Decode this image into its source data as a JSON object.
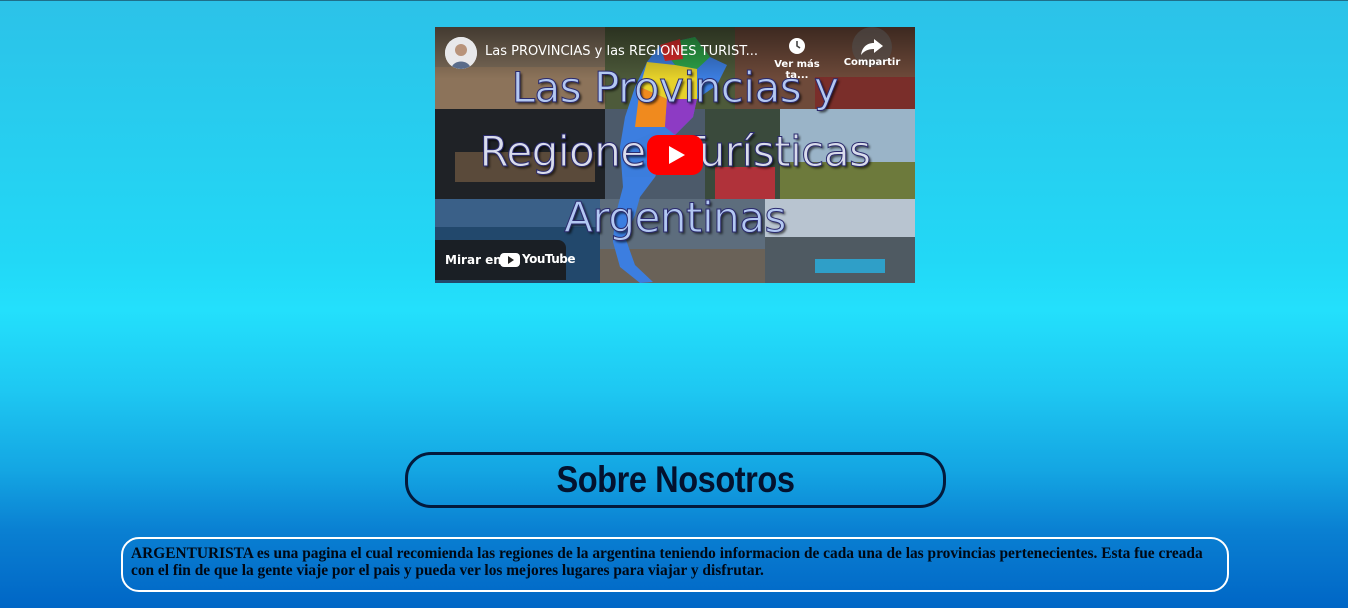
{
  "video": {
    "title": "Las PROVINCIAS y las REGIONES TURÍST...",
    "watch_later_label": "Ver más ta...",
    "share_label": "Compartir",
    "overlay_lines": [
      "Las Provincias y",
      "Regiones Turísticas",
      "Argentinas"
    ],
    "watch_on_label": "Mirar en",
    "youtube_logo_text": "YouTube",
    "icons": {
      "play": "play-icon",
      "clock": "clock-icon",
      "share": "share-icon",
      "avatar": "channel-avatar",
      "youtube": "youtube-logo-icon"
    },
    "colors": {
      "play_button": "#ff0000"
    }
  },
  "about": {
    "heading": "Sobre Nosotros",
    "text": "ARGENTURISTA es una pagina el cual recomienda las regiones de la argentina teniendo informacion de cada una de las provincias pertenecientes. Esta fue creada con el fin de que la gente viaje por el pais y pueda ver los mejores lugares para viajar y disfrutar."
  },
  "colors": {
    "background_top": "#2cc2e8",
    "background_mid": "#23e0fc",
    "background_bottom": "#0066c6",
    "heading_text": "#03122e",
    "heading_border": "#031a3c",
    "text_box_border": "#ffffff"
  }
}
